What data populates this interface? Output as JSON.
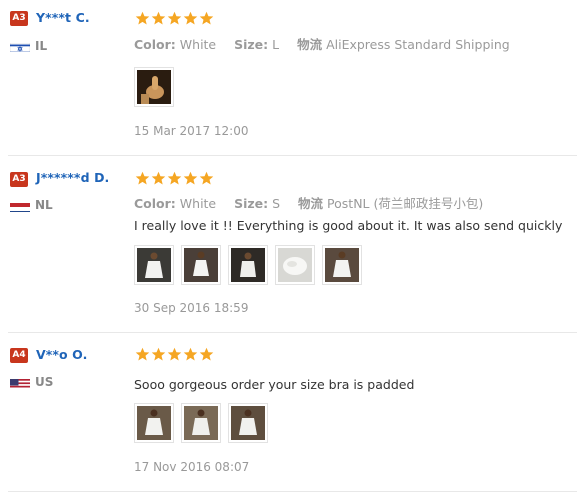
{
  "colors": {
    "accent_name": "#1f64b8",
    "level_badge": "#c8361d",
    "star": "#f5a623"
  },
  "reviews": [
    {
      "level": "A3",
      "name": "Y***t C.",
      "country": "IL",
      "flag_icon": "israel-flag-icon",
      "rating": 5,
      "color_label": "Color:",
      "color_value": "White",
      "size_label": "Size:",
      "size_value": "L",
      "shipping_label": "物流",
      "shipping_value": "AliExpress Standard Shipping",
      "text": "",
      "photo_count": 1,
      "date": "15 Mar 2017 12:00"
    },
    {
      "level": "A3",
      "name": "J******d D.",
      "country": "NL",
      "flag_icon": "netherlands-flag-icon",
      "rating": 5,
      "color_label": "Color:",
      "color_value": "White",
      "size_label": "Size:",
      "size_value": "S",
      "shipping_label": "物流",
      "shipping_value": "PostNL (荷兰邮政挂号小包)",
      "text": "I really love it !! Everything is good about it. It was also send quickly",
      "photo_count": 5,
      "date": "30 Sep 2016 18:59"
    },
    {
      "level": "A4",
      "name": "V**o O.",
      "country": "US",
      "flag_icon": "usa-flag-icon",
      "rating": 5,
      "text": "Sooo gorgeous order your size bra is padded",
      "photo_count": 3,
      "date": "17 Nov 2016 08:07"
    }
  ]
}
